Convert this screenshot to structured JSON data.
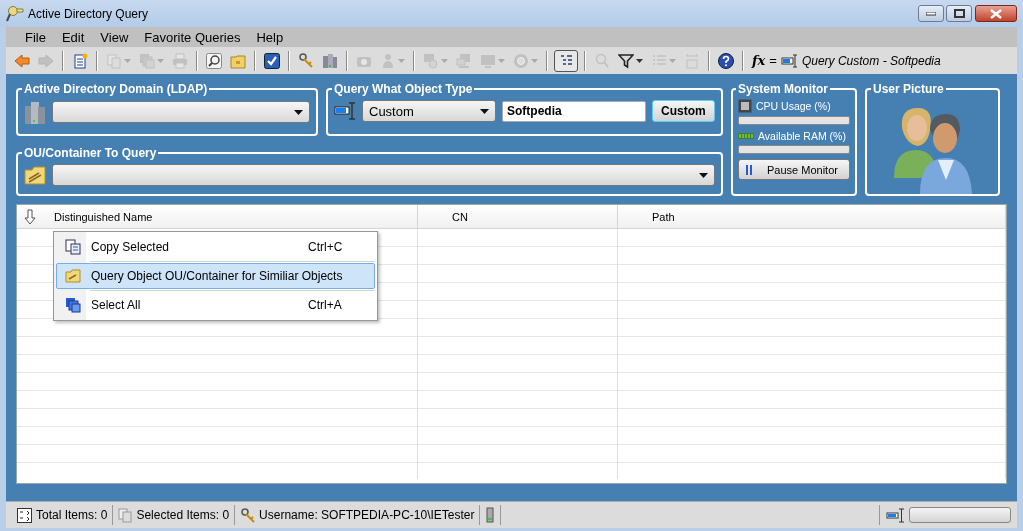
{
  "window": {
    "title": "Active Directory Query"
  },
  "menu": [
    "File",
    "Edit",
    "View",
    "Favorite Queries",
    "Help"
  ],
  "toolbar": {
    "items": [
      {
        "kind": "back",
        "disabled": false,
        "dropdown": false,
        "pressed": false
      },
      {
        "kind": "forward",
        "disabled": true,
        "dropdown": false,
        "pressed": false
      },
      {
        "kind": "separator"
      },
      {
        "kind": "new",
        "disabled": false,
        "dropdown": false,
        "pressed": false
      },
      {
        "kind": "separator"
      },
      {
        "kind": "copy",
        "disabled": true,
        "dropdown": true,
        "pressed": false
      },
      {
        "kind": "stack",
        "disabled": true,
        "dropdown": true,
        "pressed": false
      },
      {
        "kind": "print",
        "disabled": true,
        "dropdown": false,
        "pressed": false
      },
      {
        "kind": "separator"
      },
      {
        "kind": "search",
        "disabled": false,
        "dropdown": false,
        "pressed": false
      },
      {
        "kind": "folder",
        "disabled": false,
        "dropdown": false,
        "pressed": false
      },
      {
        "kind": "separator"
      },
      {
        "kind": "check",
        "disabled": false,
        "dropdown": false,
        "pressed": false
      },
      {
        "kind": "separator"
      },
      {
        "kind": "keys",
        "disabled": false,
        "dropdown": false,
        "pressed": false
      },
      {
        "kind": "servers",
        "disabled": false,
        "dropdown": false,
        "pressed": false
      },
      {
        "kind": "separator"
      },
      {
        "kind": "camera",
        "disabled": true,
        "dropdown": false,
        "pressed": false
      },
      {
        "kind": "user",
        "disabled": true,
        "dropdown": true,
        "pressed": false
      },
      {
        "kind": "separator"
      },
      {
        "kind": "network",
        "disabled": true,
        "dropdown": true,
        "pressed": false
      },
      {
        "kind": "computers",
        "disabled": true,
        "dropdown": false,
        "pressed": false
      },
      {
        "kind": "monitor",
        "disabled": true,
        "dropdown": true,
        "pressed": false
      },
      {
        "kind": "ring",
        "disabled": true,
        "dropdown": true,
        "pressed": false
      },
      {
        "kind": "separator"
      },
      {
        "kind": "tree",
        "disabled": false,
        "dropdown": false,
        "pressed": true
      },
      {
        "kind": "separator"
      },
      {
        "kind": "finduser",
        "disabled": true,
        "dropdown": false,
        "pressed": false
      },
      {
        "kind": "filter",
        "disabled": false,
        "dropdown": true,
        "pressed": false
      },
      {
        "kind": "list",
        "disabled": true,
        "dropdown": true,
        "pressed": false
      },
      {
        "kind": "resize",
        "disabled": true,
        "dropdown": false,
        "pressed": false
      },
      {
        "kind": "separator"
      },
      {
        "kind": "help",
        "disabled": false,
        "dropdown": false,
        "pressed": false
      },
      {
        "kind": "separator"
      }
    ],
    "formula": {
      "symbol": "fx",
      "equals": "=",
      "text": "Query Custom - Softpedia"
    }
  },
  "ldap_panel": {
    "title": "Active Directory Domain (LDAP)"
  },
  "object_type_panel": {
    "title": "Query What Object Type",
    "type": "Custom",
    "name": "Softpedia",
    "button": "Custom"
  },
  "system_monitor": {
    "title": "System Monitor",
    "meters": [
      {
        "kind": "cpu",
        "label": "CPU Usage (%)",
        "level": 0
      },
      {
        "kind": "ram",
        "label": "Available RAM (%)",
        "level": 0
      }
    ],
    "button": "Pause Monitor"
  },
  "user_picture": {
    "title": "User Picture"
  },
  "ou_panel": {
    "title": "OU/Container To Query"
  },
  "table": {
    "columns": [
      "Distinguished Name",
      "CN",
      "Path"
    ]
  },
  "context_menu": {
    "items": [
      {
        "kind": "copy",
        "label": "Copy Selected",
        "shortcut": "Ctrl+C",
        "selected": false
      },
      {
        "kind": "separator"
      },
      {
        "kind": "query",
        "label": "Query Object OU/Container for Similiar Objects",
        "selected": true
      },
      {
        "kind": "separator"
      },
      {
        "kind": "select_all",
        "label": "Select All",
        "shortcut": "Ctrl+A",
        "selected": false
      }
    ]
  },
  "status_bar": {
    "total": "Total Items: 0",
    "selected": "Selected Items: 0",
    "username": "Username: SOFTPEDIA-PC-10\\IETester",
    "level": 0
  }
}
